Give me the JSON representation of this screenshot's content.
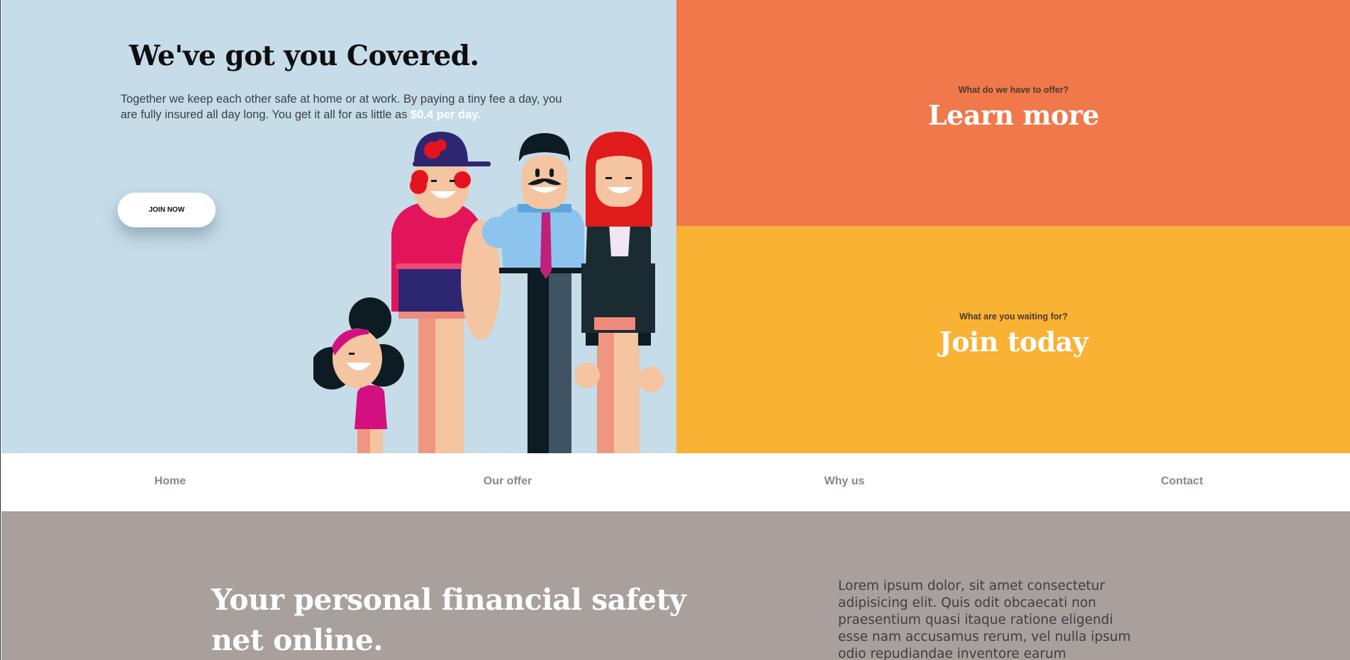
{
  "hero": {
    "title": "We've got you Covered.",
    "text": "Together we keep each other safe at home or at work. By paying a tiny fee a day, you are fully insured all day long. You get it all for as little as ",
    "price": "$0.4 per day.",
    "cta_label": "JOIN NOW",
    "illustration": "family-illustration"
  },
  "panels": {
    "offer": {
      "eyebrow": "What do we have to offer?",
      "heading": "Learn more"
    },
    "join": {
      "eyebrow": "What are you waiting for?",
      "heading": "Join today"
    }
  },
  "nav": {
    "items": [
      {
        "label": "Home"
      },
      {
        "label": "Our offer"
      },
      {
        "label": "Why us"
      },
      {
        "label": "Contact"
      }
    ]
  },
  "section": {
    "title": "Your personal financial safety net online.",
    "text": "Lorem ipsum dolor, sit amet consectetur adipisicing elit. Quis odit obcaecati non praesentium quasi itaque ratione eligendi esse nam accusamus rerum, vel nulla ipsum odio repudiandae inventore earum"
  },
  "colors": {
    "hero_bg": "#c6dce8",
    "offer_bg": "#f0784a",
    "join_bg": "#f9b233",
    "section_bg": "#a7a09c"
  }
}
